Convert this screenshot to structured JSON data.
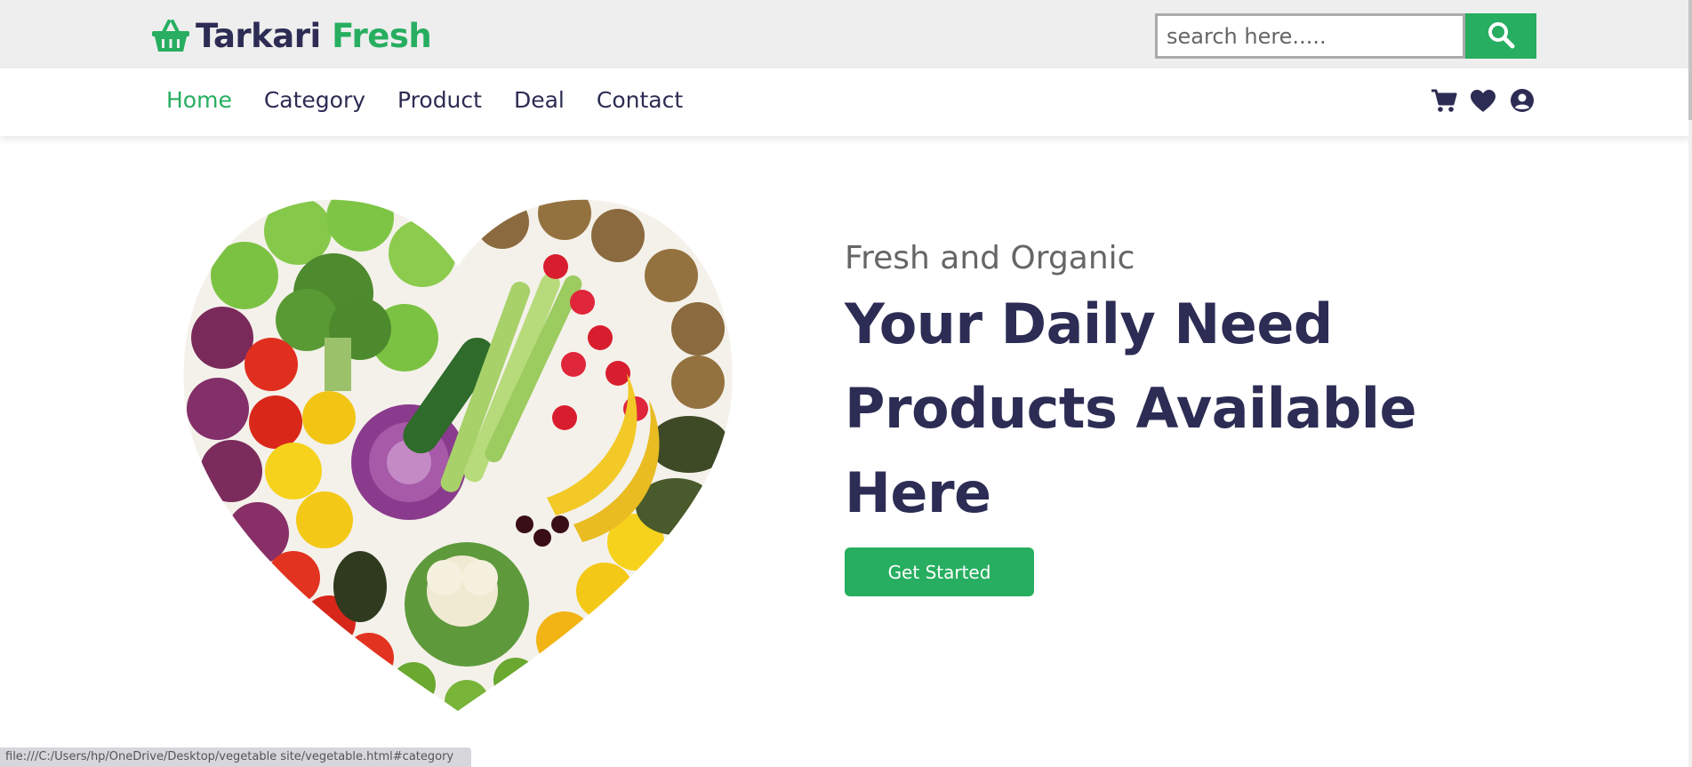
{
  "header": {
    "brand_primary": "Tarkari",
    "brand_accent": "Fresh",
    "logo_icon": "basket-icon",
    "search": {
      "placeholder": "search here.....",
      "value": "",
      "icon": "search-icon"
    }
  },
  "nav": {
    "links": [
      {
        "label": "Home",
        "active": true
      },
      {
        "label": "Category",
        "active": false
      },
      {
        "label": "Product",
        "active": false
      },
      {
        "label": "Deal",
        "active": false
      },
      {
        "label": "Contact",
        "active": false
      }
    ],
    "icons": [
      "cart-icon",
      "heart-icon",
      "user-circle-icon"
    ]
  },
  "hero": {
    "kicker": "Fresh and Organic",
    "title": "Your Daily Need Products Available Here",
    "button_label": "Get Started",
    "image": "heart-shaped-vegetables-and-fruits-image"
  },
  "status_bar": {
    "url": "file:///C:/Users/hp/OneDrive/Desktop/vegetable site/vegetable.html#category"
  },
  "colors": {
    "accent": "#27ae60",
    "text_dark": "#2c2c54",
    "topbar_bg": "#eeeeee"
  }
}
